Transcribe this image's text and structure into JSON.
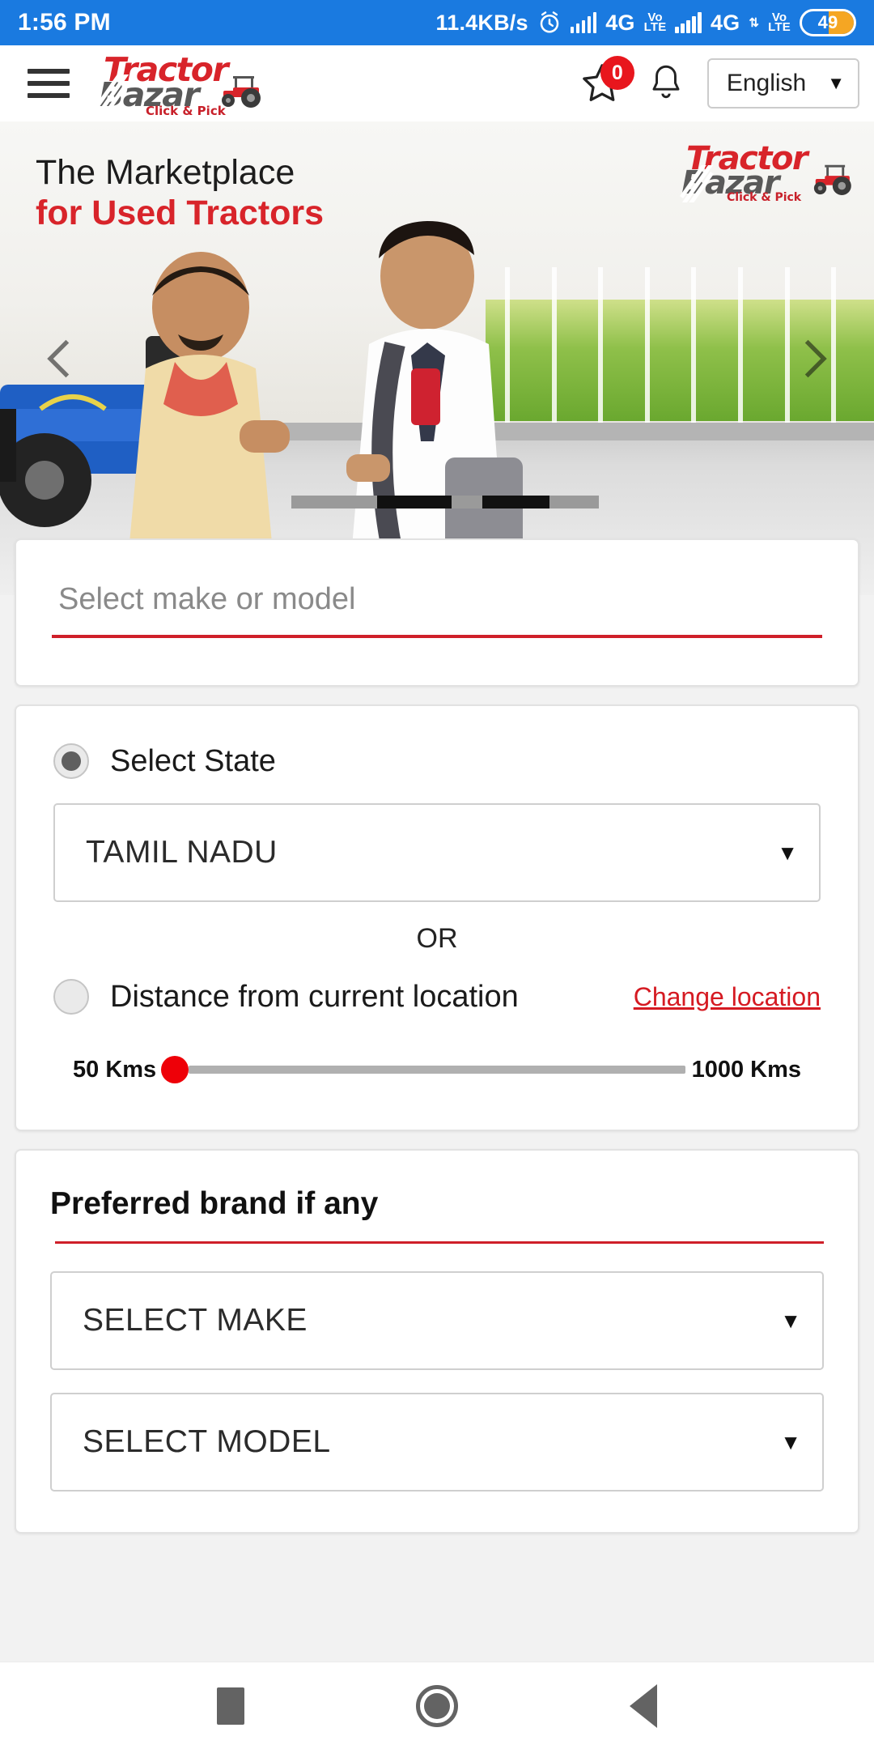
{
  "statusbar": {
    "time": "1:56 PM",
    "network_speed": "11.4KB/s",
    "alarm_icon": "alarm-clock-icon",
    "sim1_network": "4G",
    "sim1_volte": "Vo",
    "sim1_volte2": "LTE",
    "sim2_network": "4G",
    "sim2_volte": "Vo",
    "sim2_volte2": "LTE",
    "battery_percent": "49"
  },
  "header": {
    "menu_icon": "hamburger-menu-icon",
    "logo_top": "Tractor",
    "logo_bottom": "Bazar",
    "logo_tagline": "Click & Pick",
    "favorites_icon": "star-icon",
    "favorites_badge": "0",
    "notifications_icon": "bell-icon",
    "language": "English",
    "language_caret": "▼"
  },
  "hero": {
    "line1": "The Marketplace",
    "line2": "for Used Tractors",
    "logo_top": "Tractor",
    "logo_bottom": "Bazar",
    "logo_tagline": "Click & Pick",
    "prev_icon": "chevron-left-icon",
    "next_icon": "chevron-right-icon"
  },
  "search": {
    "placeholder": "Select make or model",
    "value": ""
  },
  "location": {
    "state_radio_label": "Select State",
    "state_radio_checked": true,
    "state_value": "TAMIL NADU",
    "state_caret": "▼",
    "or_text": "OR",
    "distance_radio_label": "Distance from current location",
    "distance_radio_checked": false,
    "change_location_link": "Change location",
    "slider_min_label": "50 Kms",
    "slider_max_label": "1000 Kms",
    "slider_value": 50,
    "slider_min": 50,
    "slider_max": 1000
  },
  "brand": {
    "title": "Preferred brand if any",
    "make_value": "SELECT MAKE",
    "make_caret": "▼",
    "model_value": "SELECT MODEL",
    "model_caret": "▼"
  },
  "navbar": {
    "recents_icon": "square-recents-icon",
    "home_icon": "circle-home-icon",
    "back_icon": "triangle-back-icon"
  },
  "colors": {
    "status_blue": "#1a7ae0",
    "brand_red": "#d8242a",
    "brand_gray": "#595959",
    "accent_underline": "#cf1f29",
    "badge_red": "#e8161d",
    "battery_orange": "#f5a623"
  }
}
